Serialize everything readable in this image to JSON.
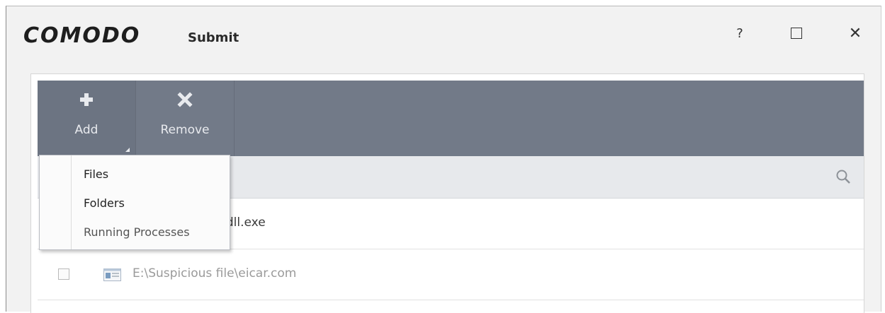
{
  "window": {
    "logo_text": "COMODO",
    "title": "Submit",
    "help_label": "?",
    "close_label": "✕"
  },
  "toolbar": {
    "add_label": "Add",
    "add_icon": "plus-icon",
    "remove_label": "Remove",
    "remove_icon": "x-icon"
  },
  "add_menu": {
    "items": [
      {
        "label": "Files"
      },
      {
        "label": "Folders"
      },
      {
        "label": "Running Processes"
      }
    ]
  },
  "search": {
    "icon": "search-icon"
  },
  "files": [
    {
      "path": "Desktop\\vir\\rundll.exe",
      "checked": false
    },
    {
      "path": "E:\\Suspicious file\\eicar.com",
      "checked": false
    }
  ],
  "colors": {
    "toolbar_bg": "#727a88",
    "search_row_bg": "#e7e9ec",
    "window_bg": "#f2f2f2"
  }
}
